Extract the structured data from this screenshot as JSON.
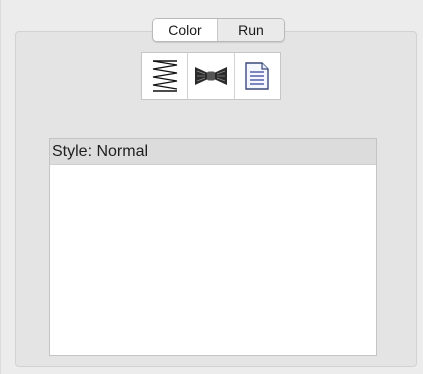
{
  "tabs": {
    "color_label": "Color",
    "run_label": "Run",
    "selected": "Color"
  },
  "toolbar": {
    "buttons": [
      {
        "icon": "zigzag-lines-icon"
      },
      {
        "icon": "bowtie-icon"
      },
      {
        "icon": "document-icon"
      }
    ]
  },
  "style_list": {
    "items": [
      {
        "label": "Style: Normal"
      }
    ]
  }
}
